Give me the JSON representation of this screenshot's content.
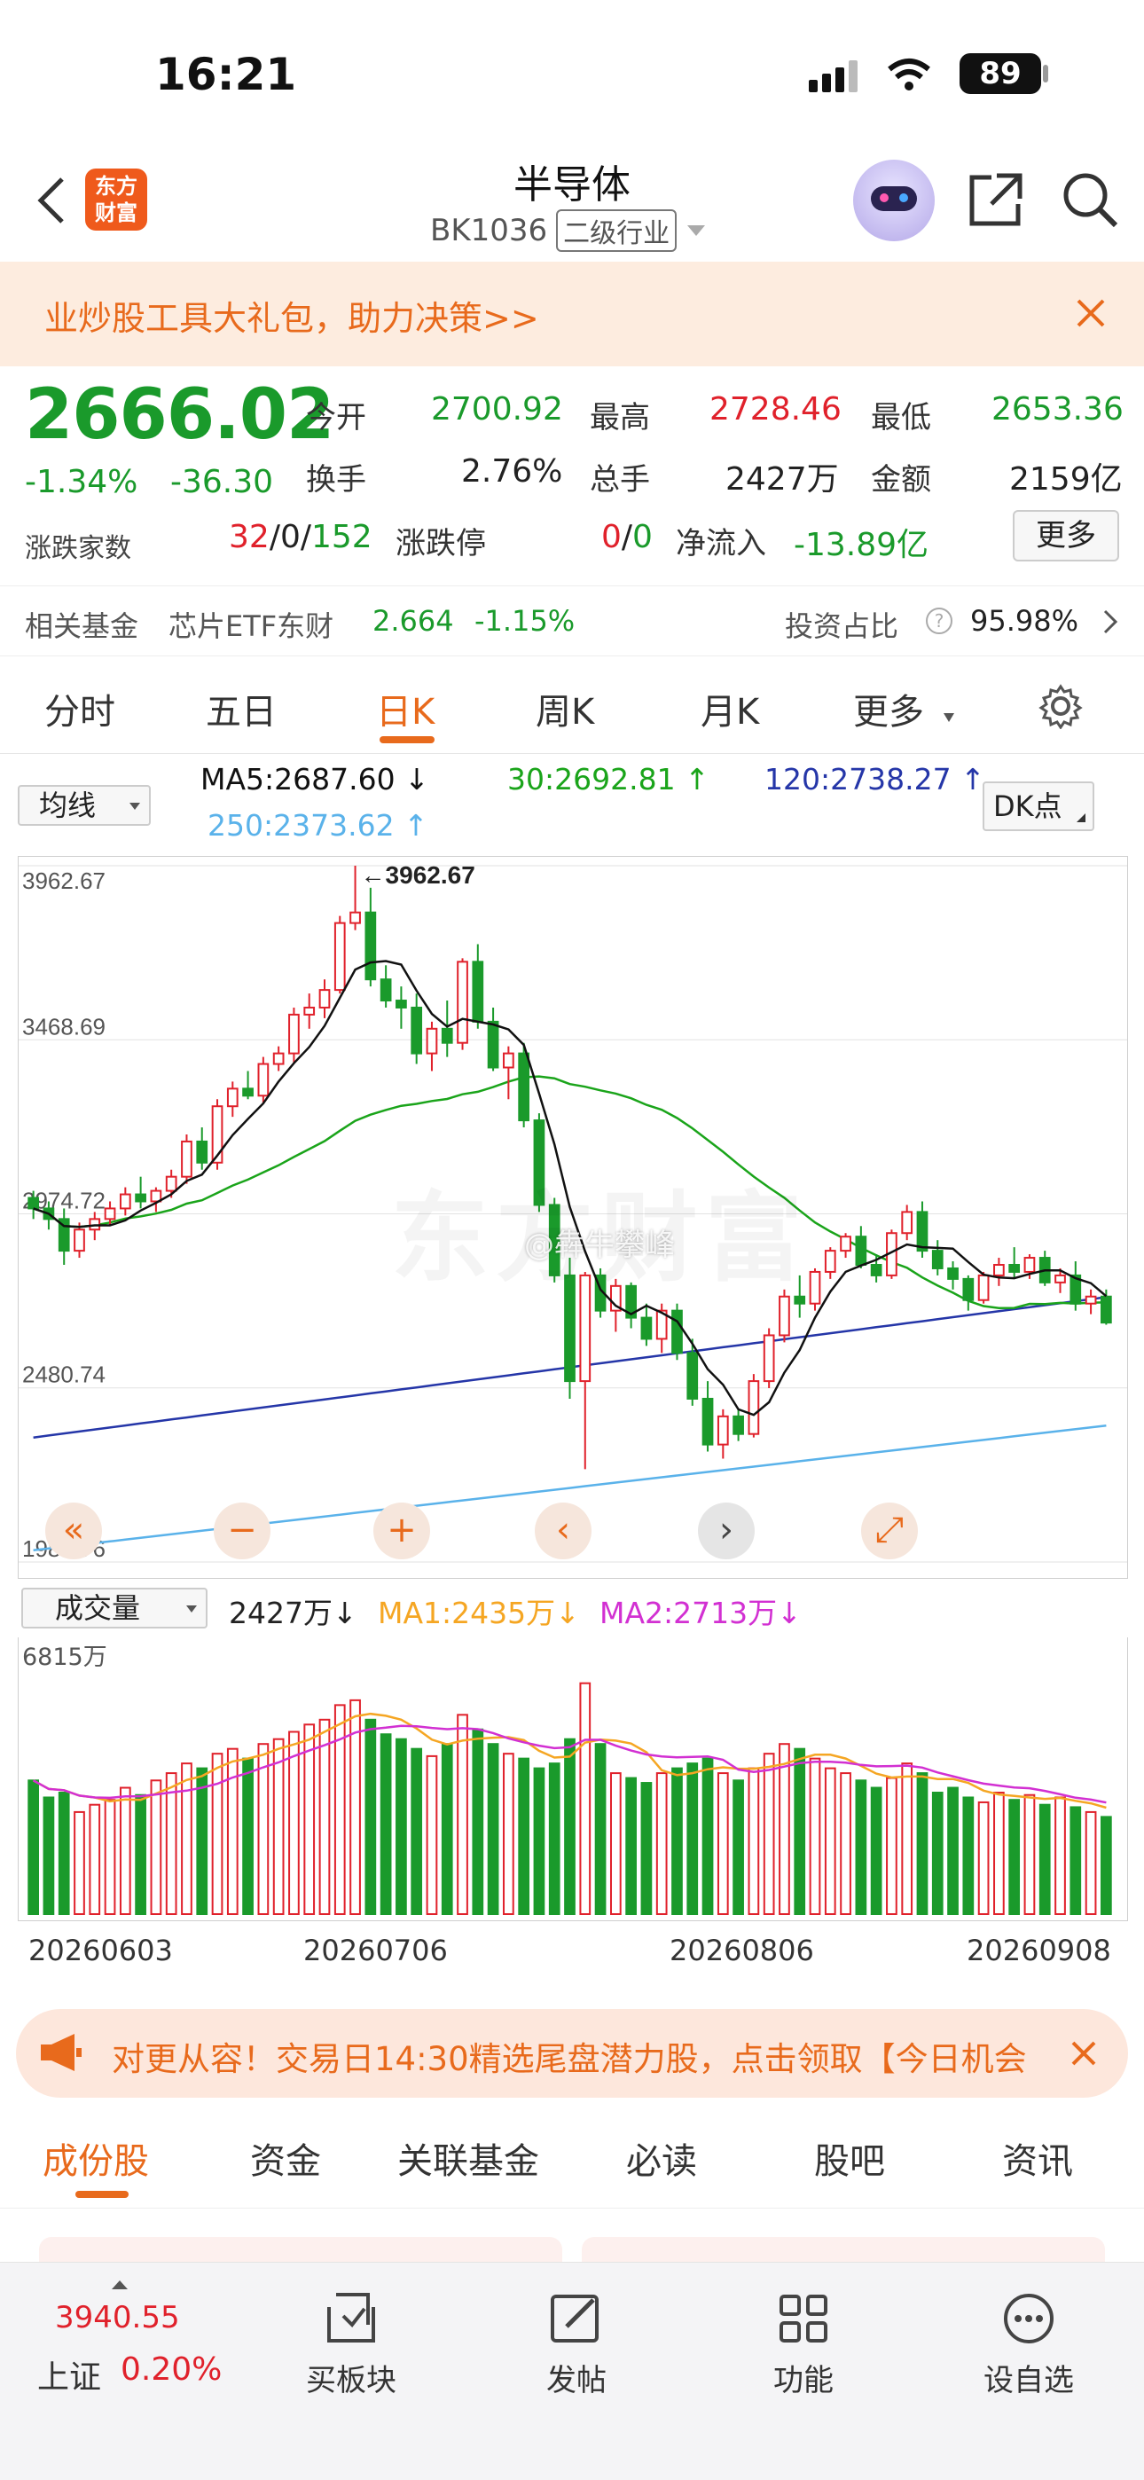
{
  "status_bar": {
    "time": "16:21",
    "battery": "89"
  },
  "header": {
    "title": "半导体",
    "code": "BK1036",
    "industry_tag": "二级行业",
    "logo_text_1": "东方",
    "logo_text_2": "财富"
  },
  "banner": {
    "text": "业炒股工具大礼包，助力决策>>"
  },
  "quote": {
    "price": "2666.02",
    "change_pct": "-1.34%",
    "change": "-36.30",
    "open_label": "今开",
    "open": "2700.92",
    "high_label": "最高",
    "high": "2728.46",
    "low_label": "最低",
    "low": "2653.36",
    "turnover_label": "换手",
    "turnover": "2.76%",
    "volume_label": "总手",
    "volume": "2427万",
    "amount_label": "金额",
    "amount": "2159亿",
    "breadth_label": "涨跌家数",
    "breadth_up": "32",
    "breadth_flat": "0",
    "breadth_down": "152",
    "limit_label": "涨跌停",
    "limit_up": "0",
    "limit_down": "0",
    "netflow_label": "净流入",
    "netflow": "-13.89亿",
    "more_button": "更多"
  },
  "fund_row": {
    "label": "相关基金",
    "fund_name": "芯片ETF东财",
    "fund_price": "2.664",
    "fund_change": "-1.15%",
    "ratio_label": "投资占比",
    "ratio": "95.98%"
  },
  "chart_tabs": [
    "分时",
    "五日",
    "日K",
    "周K",
    "月K",
    "更多"
  ],
  "ma_legend": {
    "selector": "均线",
    "ma5": "MA5:2687.60",
    "ma30": "30:2692.81",
    "ma120": "120:2738.27",
    "ma250": "250:2373.62",
    "dk_button": "DK点"
  },
  "chart_controls": [
    "«",
    "−",
    "+",
    "‹",
    "›",
    "⤢"
  ],
  "watermark": "东方财富",
  "watermark_user": "@犇牛攀峰",
  "volume_legend": {
    "selector": "成交量",
    "vol": "2427万",
    "ma1": "MA1:2435万",
    "ma2": "MA2:2713万",
    "vol_max": "6815万"
  },
  "colors": {
    "up": "#e0212b",
    "down": "#1a9a2b",
    "ma5": "#111111",
    "ma30": "#1aa41a",
    "ma120": "#2536a8",
    "ma250": "#5ab2ea",
    "vol_ma1": "#f5a623",
    "vol_ma2": "#d230d2",
    "accent": "#e86a1c"
  },
  "chart_data": {
    "type": "candlestick",
    "title": "半导体 日K",
    "y_ticks": [
      "3962.67",
      "3468.69",
      "2974.72",
      "2480.74",
      "1986.76"
    ],
    "ylim": [
      1986.76,
      3962.67
    ],
    "x_ticks": [
      "20260603",
      "20260706",
      "20260806",
      "20260908"
    ],
    "max_annotation": "←3962.67",
    "candles": [
      [
        3020,
        3040,
        2960,
        2990
      ],
      [
        2990,
        3010,
        2930,
        2960
      ],
      [
        2960,
        2990,
        2830,
        2870
      ],
      [
        2870,
        2950,
        2850,
        2930
      ],
      [
        2930,
        2980,
        2900,
        2960
      ],
      [
        2960,
        3010,
        2940,
        2990
      ],
      [
        2990,
        3050,
        2970,
        3030
      ],
      [
        3030,
        3080,
        2990,
        3010
      ],
      [
        3010,
        3050,
        2980,
        3040
      ],
      [
        3040,
        3100,
        3020,
        3080
      ],
      [
        3080,
        3200,
        3060,
        3180
      ],
      [
        3180,
        3220,
        3100,
        3120
      ],
      [
        3120,
        3300,
        3100,
        3280
      ],
      [
        3280,
        3350,
        3250,
        3330
      ],
      [
        3330,
        3380,
        3300,
        3310
      ],
      [
        3310,
        3420,
        3290,
        3400
      ],
      [
        3400,
        3450,
        3380,
        3430
      ],
      [
        3430,
        3560,
        3400,
        3540
      ],
      [
        3540,
        3600,
        3500,
        3560
      ],
      [
        3560,
        3640,
        3530,
        3610
      ],
      [
        3610,
        3820,
        3600,
        3800
      ],
      [
        3800,
        3962.67,
        3780,
        3830
      ],
      [
        3830,
        3900,
        3620,
        3640
      ],
      [
        3640,
        3680,
        3560,
        3580
      ],
      [
        3580,
        3620,
        3500,
        3560
      ],
      [
        3560,
        3600,
        3400,
        3430
      ],
      [
        3430,
        3520,
        3380,
        3500
      ],
      [
        3500,
        3580,
        3420,
        3460
      ],
      [
        3460,
        3700,
        3440,
        3690
      ],
      [
        3690,
        3740,
        3500,
        3520
      ],
      [
        3520,
        3560,
        3380,
        3390
      ],
      [
        3390,
        3450,
        3300,
        3430
      ],
      [
        3430,
        3460,
        3220,
        3240
      ],
      [
        3240,
        3260,
        2980,
        3000
      ],
      [
        3000,
        3020,
        2780,
        2800
      ],
      [
        2800,
        2850,
        2450,
        2500
      ],
      [
        2500,
        2810,
        2250,
        2800
      ],
      [
        2800,
        2820,
        2680,
        2700
      ],
      [
        2700,
        2790,
        2640,
        2770
      ],
      [
        2770,
        2780,
        2650,
        2680
      ],
      [
        2680,
        2720,
        2600,
        2620
      ],
      [
        2620,
        2720,
        2580,
        2700
      ],
      [
        2700,
        2720,
        2560,
        2580
      ],
      [
        2580,
        2620,
        2430,
        2450
      ],
      [
        2450,
        2500,
        2300,
        2320
      ],
      [
        2320,
        2420,
        2280,
        2400
      ],
      [
        2400,
        2420,
        2330,
        2350
      ],
      [
        2350,
        2520,
        2340,
        2500
      ],
      [
        2500,
        2650,
        2480,
        2630
      ],
      [
        2630,
        2760,
        2610,
        2740
      ],
      [
        2740,
        2800,
        2680,
        2720
      ],
      [
        2720,
        2820,
        2700,
        2810
      ],
      [
        2810,
        2880,
        2790,
        2870
      ],
      [
        2870,
        2920,
        2850,
        2910
      ],
      [
        2910,
        2940,
        2820,
        2830
      ],
      [
        2830,
        2860,
        2780,
        2800
      ],
      [
        2800,
        2930,
        2790,
        2920
      ],
      [
        2920,
        3000,
        2900,
        2980
      ],
      [
        2980,
        3010,
        2850,
        2870
      ],
      [
        2870,
        2900,
        2800,
        2820
      ],
      [
        2820,
        2840,
        2760,
        2790
      ],
      [
        2790,
        2800,
        2700,
        2730
      ],
      [
        2730,
        2810,
        2720,
        2800
      ],
      [
        2800,
        2850,
        2770,
        2830
      ],
      [
        2830,
        2880,
        2790,
        2810
      ],
      [
        2810,
        2860,
        2790,
        2850
      ],
      [
        2850,
        2870,
        2770,
        2780
      ],
      [
        2780,
        2820,
        2750,
        2800
      ],
      [
        2800,
        2840,
        2700,
        2720
      ],
      [
        2720,
        2760,
        2690,
        2740
      ],
      [
        2740,
        2760,
        2660,
        2666.02
      ]
    ],
    "volume_values": [
      55,
      48,
      50,
      42,
      45,
      47,
      52,
      49,
      55,
      58,
      62,
      60,
      66,
      68,
      64,
      70,
      72,
      75,
      78,
      80,
      86,
      88,
      80,
      74,
      72,
      68,
      65,
      70,
      82,
      76,
      70,
      66,
      64,
      60,
      62,
      72,
      95,
      70,
      58,
      56,
      54,
      58,
      60,
      62,
      64,
      58,
      55,
      60,
      66,
      70,
      68,
      64,
      60,
      58,
      55,
      52,
      56,
      62,
      58,
      50,
      52,
      48,
      46,
      50,
      47,
      49,
      45,
      48,
      44,
      42,
      40
    ]
  },
  "ad": {
    "text": "对更从容！交易日14:30精选尾盘潜力股，点击领取【今日机会"
  },
  "bottom_tabs": [
    "成份股",
    "资金",
    "关联基金",
    "必读",
    "股吧",
    "资讯"
  ],
  "dock": {
    "index_value": "3940.55",
    "index_name": "上证",
    "index_change": "0.20%",
    "items": [
      "买板块",
      "发帖",
      "功能",
      "设自选"
    ]
  }
}
